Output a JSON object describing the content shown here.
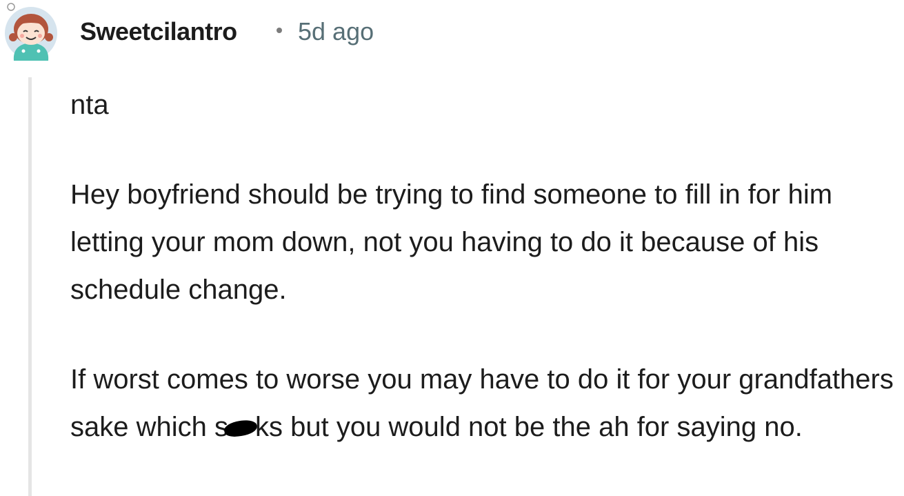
{
  "comment": {
    "author": "Sweetcilantro",
    "separator": "•",
    "timestamp": "5d ago",
    "avatar_icon": "cartoon-girl-avatar-icon",
    "paragraphs": {
      "p1": "nta",
      "p2": "Hey boyfriend should be trying to find someone to fill in for him letting your mom down, not you having to do it because of his schedule change.",
      "p3_before": "If worst comes to worse you may have to do it for your grandfathers sake which s",
      "p3_after": "ks but you would not be the ah for saying no."
    }
  },
  "colors": {
    "text": "#1c1c1c",
    "timestamp": "#576f76",
    "thread_line": "#e5e5e5",
    "avatar_bg": "#d6e4ee",
    "avatar_shirt": "#4fc1b3",
    "avatar_hair": "#b2553d"
  }
}
